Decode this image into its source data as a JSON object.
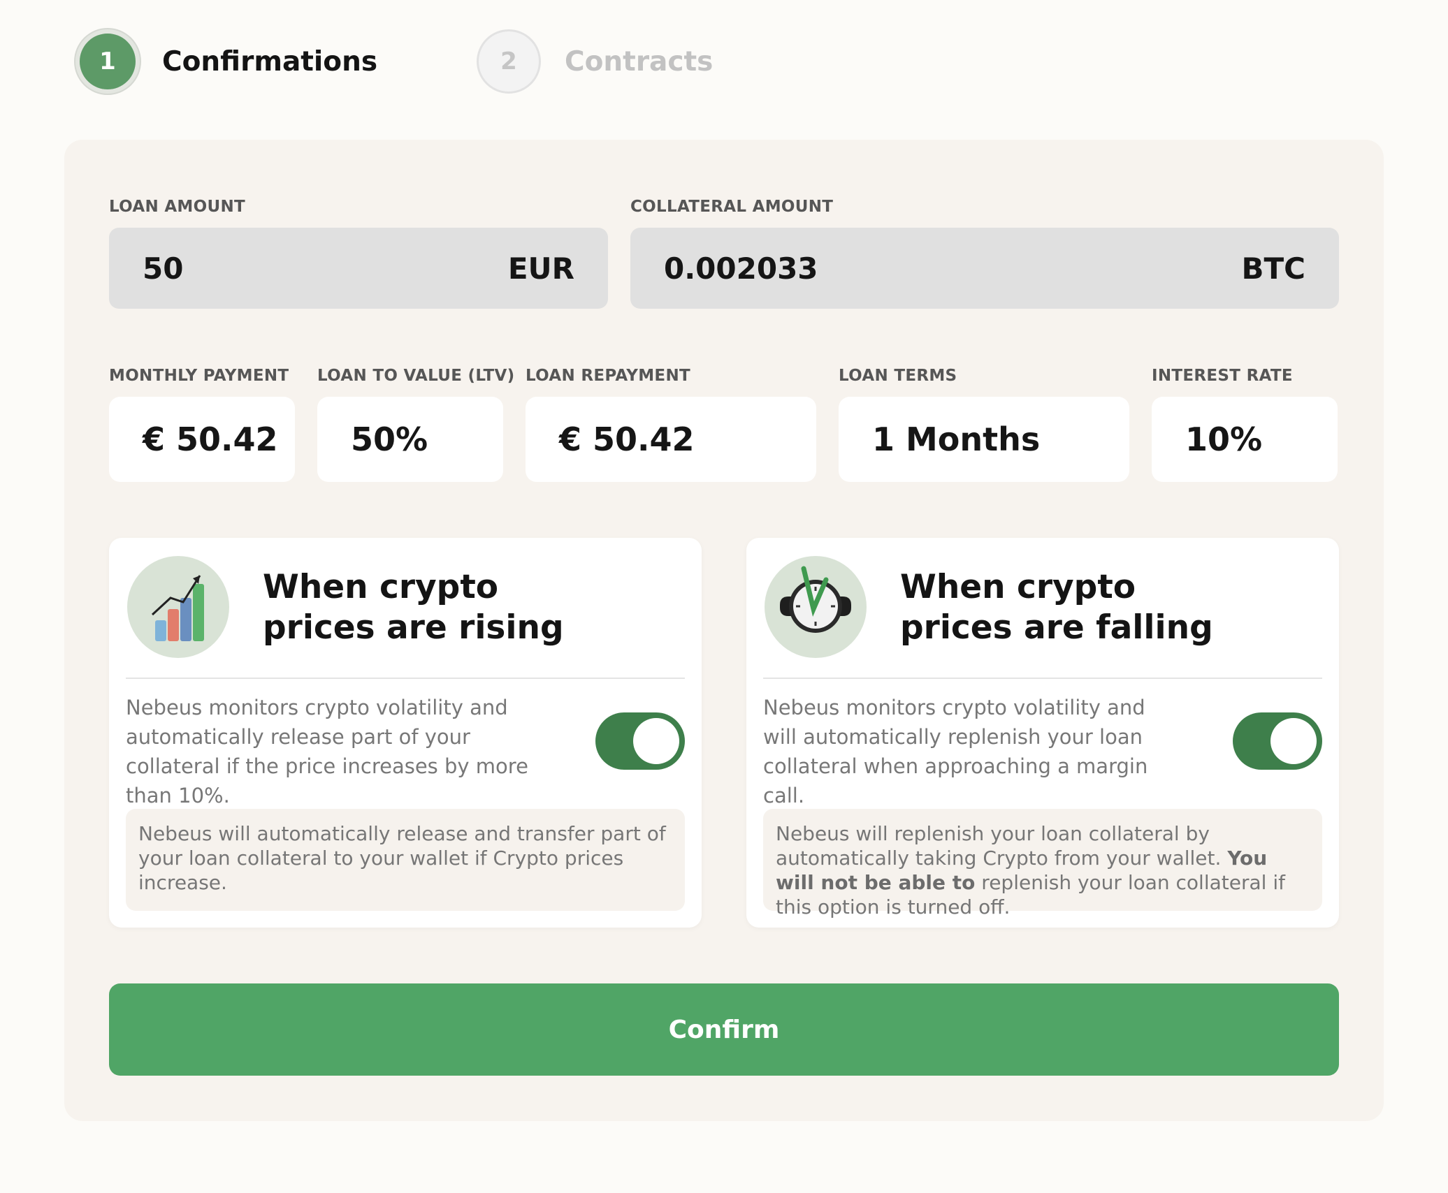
{
  "stepper": {
    "steps": [
      {
        "number": "1",
        "label": "Confirmations",
        "state": "active"
      },
      {
        "number": "2",
        "label": "Contracts",
        "state": "inactive"
      }
    ]
  },
  "loan_amount": {
    "label": "LOAN AMOUNT",
    "value": "50",
    "currency": "EUR"
  },
  "collateral_amount": {
    "label": "COLLATERAL AMOUNT",
    "value": "0.002033",
    "currency": "BTC"
  },
  "stats": {
    "monthly_payment": {
      "label": "MONTHLY PAYMENT",
      "value": "€ 50.42"
    },
    "ltv": {
      "label": "LOAN TO VALUE (LTV)",
      "value": "50%"
    },
    "loan_repayment": {
      "label": "LOAN REPAYMENT",
      "value": "€ 50.42"
    },
    "loan_terms": {
      "label": "LOAN TERMS",
      "value": "1 Months"
    },
    "interest_rate": {
      "label": "INTEREST RATE",
      "value": "10%"
    }
  },
  "cards": {
    "rising": {
      "icon": "rising-chart-icon",
      "title_line1": "When crypto",
      "title_line2": "prices are rising",
      "description": "Nebeus monitors crypto volatility and automatically release part of your collateral if the price increases by more than 10%.",
      "toggle_on": true,
      "note": "Nebeus will automatically release and transfer part of your loan collateral to your wallet if Crypto prices increase."
    },
    "falling": {
      "icon": "stopwatch-icon",
      "title_line1": "When crypto",
      "title_line2": "prices are falling",
      "description": "Nebeus monitors crypto volatility and will automatically replenish your loan collateral when approaching a margin call.",
      "toggle_on": true,
      "note_start": "Nebeus will replenish your loan collateral by automatically taking Crypto from your wallet.",
      "note_bold": "You will not be able to",
      "note_end": "replenish your loan collateral if this option is turned off."
    }
  },
  "confirm_label": "Confirm",
  "colors": {
    "accent_green": "#50a566",
    "toggle_green": "#3e7f4b",
    "step_active": "#5d9a67",
    "panel_bg": "#f7f3ee"
  }
}
